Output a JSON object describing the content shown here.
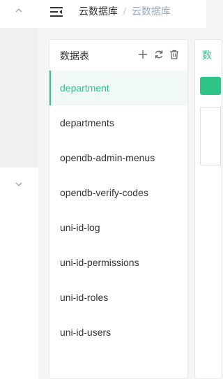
{
  "breadcrumb": {
    "items": [
      "云数据库",
      "云数据库"
    ],
    "separator": "/"
  },
  "panel": {
    "title": "数据表"
  },
  "toolbar": {
    "icons": [
      "plus-icon",
      "refresh-icon",
      "trash-icon"
    ]
  },
  "collections": [
    {
      "label": "department",
      "active": true
    },
    {
      "label": "departments"
    },
    {
      "label": "opendb-admin-menus"
    },
    {
      "label": "opendb-verify-codes"
    },
    {
      "label": "uni-id-log"
    },
    {
      "label": "uni-id-permissions"
    },
    {
      "label": "uni-id-roles"
    },
    {
      "label": "uni-id-users"
    }
  ],
  "right_tab": {
    "label": "数"
  },
  "colors": {
    "accent": "#2ec486",
    "active_bg": "#f0f9f5",
    "breadcrumb_current": "#97a8be"
  }
}
